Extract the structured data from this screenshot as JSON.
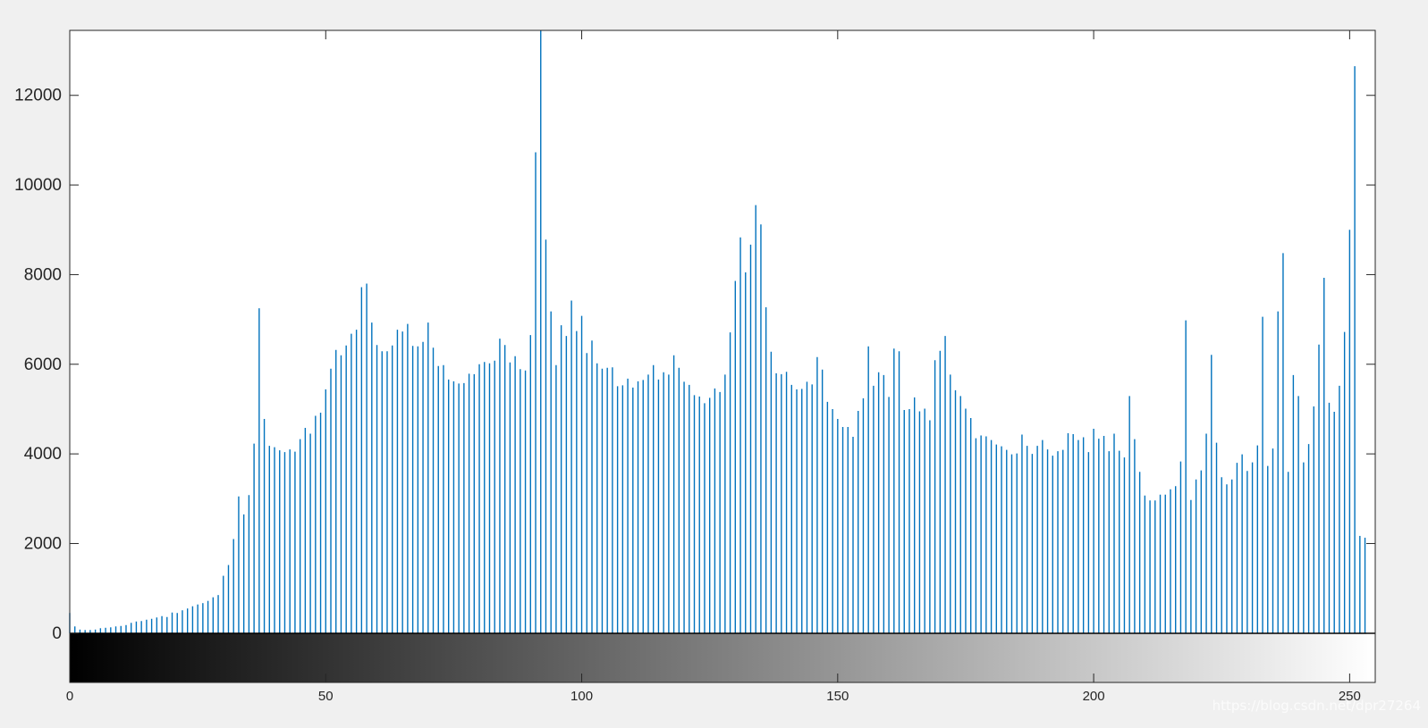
{
  "colors": {
    "background": "#f0f0f0",
    "axes_background": "#ffffff",
    "stem": "#0072bd",
    "axis": "#262626"
  },
  "watermark": "https://blog.csdn.net/dpr27264",
  "chart_data": {
    "type": "bar",
    "title": "",
    "xlabel": "",
    "ylabel": "",
    "xlim": [
      0,
      255
    ],
    "ylim": [
      -1100,
      13450
    ],
    "xticks": [
      0,
      50,
      100,
      150,
      200,
      250
    ],
    "yticks": [
      0,
      2000,
      4000,
      6000,
      8000,
      10000,
      12000
    ],
    "grid": false,
    "colorbar": "grayscale",
    "x_start": 0,
    "values": [
      450,
      150,
      80,
      70,
      70,
      80,
      110,
      120,
      130,
      150,
      160,
      180,
      230,
      260,
      270,
      300,
      320,
      350,
      380,
      360,
      460,
      450,
      510,
      550,
      600,
      640,
      670,
      720,
      800,
      850,
      1280,
      1520,
      2100,
      3050,
      2650,
      3080,
      4230,
      7250,
      4780,
      4180,
      4150,
      4080,
      4040,
      4100,
      4050,
      4330,
      4580,
      4450,
      4850,
      4920,
      5440,
      5900,
      6320,
      6200,
      6420,
      6680,
      6770,
      7720,
      7800,
      6930,
      6430,
      6290,
      6290,
      6420,
      6770,
      6730,
      6900,
      6410,
      6400,
      6500,
      6930,
      6370,
      5960,
      5980,
      5660,
      5620,
      5570,
      5580,
      5790,
      5780,
      6000,
      6050,
      6020,
      6080,
      6570,
      6430,
      6040,
      6180,
      5890,
      5860,
      6650,
      10730,
      13450,
      8780,
      7180,
      5980,
      6870,
      6630,
      7420,
      6740,
      7080,
      6250,
      6530,
      6020,
      5900,
      5920,
      5930,
      5510,
      5530,
      5680,
      5480,
      5620,
      5650,
      5770,
      5980,
      5660,
      5820,
      5770,
      6200,
      5920,
      5610,
      5540,
      5310,
      5280,
      5130,
      5250,
      5460,
      5380,
      5770,
      6710,
      7860,
      8830,
      8050,
      8670,
      9550,
      9120,
      7270,
      6280,
      5800,
      5780,
      5830,
      5540,
      5440,
      5450,
      5610,
      5550,
      6160,
      5880,
      5160,
      5000,
      4780,
      4600,
      4600,
      4380,
      4960,
      5240,
      6400,
      5520,
      5820,
      5760,
      5270,
      6350,
      6290,
      4980,
      5000,
      5260,
      4950,
      5010,
      4750,
      6090,
      6300,
      6630,
      5770,
      5420,
      5290,
      5010,
      4800,
      4350,
      4410,
      4390,
      4310,
      4210,
      4170,
      4090,
      3990,
      4010,
      4430,
      4180,
      4000,
      4180,
      4310,
      4100,
      3960,
      4060,
      4090,
      4460,
      4440,
      4310,
      4370,
      4040,
      4560,
      4340,
      4400,
      4060,
      4450,
      4070,
      3920,
      5290,
      4330,
      3600,
      3070,
      2960,
      2960,
      3090,
      3090,
      3210,
      3280,
      3830,
      6980,
      2970,
      3430,
      3630,
      4450,
      6210,
      4250,
      3480,
      3320,
      3430,
      3800,
      3990,
      3620,
      3810,
      4190,
      7060,
      3730,
      4120,
      7180,
      8480,
      3600,
      5760,
      5290,
      3810,
      4220,
      5060,
      6440,
      7930,
      5140,
      4940,
      5520,
      6720,
      9000,
      12650,
      2170,
      2130
    ]
  }
}
